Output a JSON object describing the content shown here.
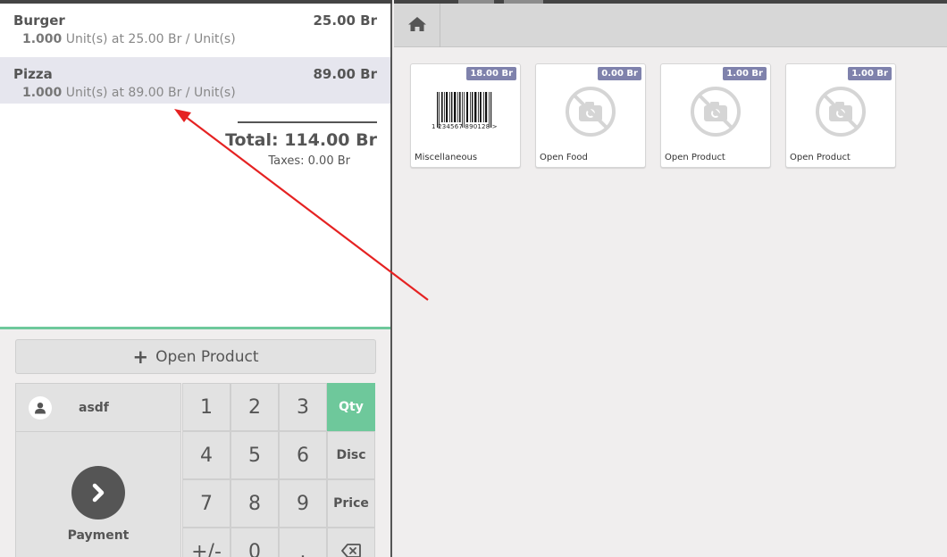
{
  "order": {
    "lines": [
      {
        "name": "Burger",
        "price": "25.00 Br",
        "qty": "1.000",
        "unit_info": "Unit(s) at 25.00 Br / Unit(s)",
        "selected": false
      },
      {
        "name": "Pizza",
        "price": "89.00 Br",
        "qty": "1.000",
        "unit_info": "Unit(s) at 89.00 Br / Unit(s)",
        "selected": true
      }
    ],
    "total": "Total: 114.00 Br",
    "taxes": "Taxes: 0.00 Br"
  },
  "actions": {
    "open_product": "Open Product",
    "customer": "asdf",
    "payment": "Payment"
  },
  "numpad": {
    "keys": [
      "1",
      "2",
      "3",
      "Qty",
      "4",
      "5",
      "6",
      "Disc",
      "7",
      "8",
      "9",
      "Price",
      "+/-",
      "0",
      ".",
      "⌫"
    ],
    "active_mode": "Qty"
  },
  "products": [
    {
      "name": "Miscellaneous",
      "price": "18.00 Br",
      "image": "barcode-image",
      "barcode_text": "1 234567 890128 >"
    },
    {
      "name": "Open Food",
      "price": "0.00 Br",
      "image": "no-photo-icon"
    },
    {
      "name": "Open Product",
      "price": "1.00 Br",
      "image": "no-photo-icon"
    },
    {
      "name": "Open Product",
      "price": "1.00 Br",
      "image": "no-photo-icon"
    }
  ],
  "colors": {
    "accent": "#6ec89b",
    "price_tag": "#7f82ac",
    "selected_line": "#e6e6ee",
    "annotation_arrow": "#e52222"
  }
}
